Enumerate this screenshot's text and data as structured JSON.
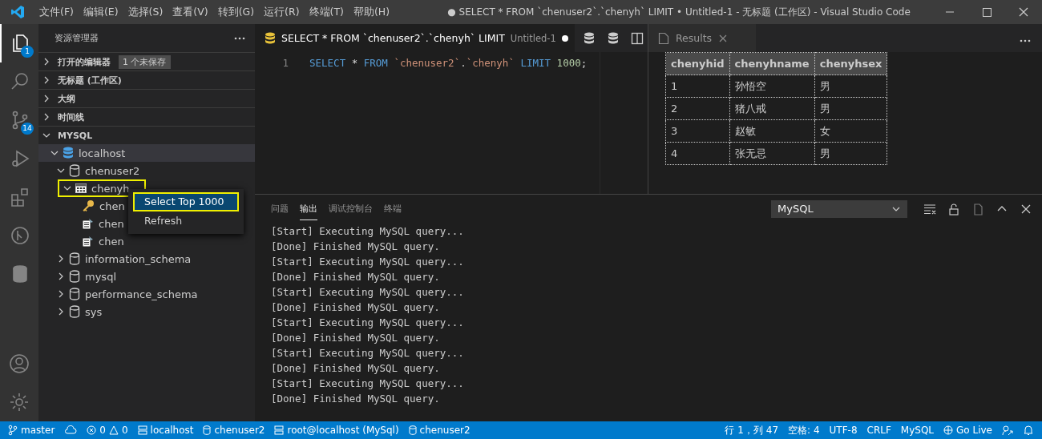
{
  "title_bar": {
    "menu": [
      "文件(F)",
      "编辑(E)",
      "选择(S)",
      "查看(V)",
      "转到(G)",
      "运行(R)",
      "终端(T)",
      "帮助(H)"
    ],
    "title": "● SELECT * FROM `chenuser2`.`chenyh` LIMIT • Untitled-1 - 无标题 (工作区) - Visual Studio Code"
  },
  "activity_bar": [
    {
      "kind": "explorer",
      "badge": "1",
      "selected": true
    },
    {
      "kind": "search",
      "selected": false
    },
    {
      "kind": "source-control",
      "badge": "14",
      "selected": false
    },
    {
      "kind": "run",
      "selected": false
    },
    {
      "kind": "extensions",
      "selected": false
    },
    {
      "kind": "git-graph",
      "selected": false
    },
    {
      "kind": "database",
      "selected": false
    }
  ],
  "sidebar": {
    "title": "资源管理器",
    "sections": [
      {
        "label": "打开的编辑器",
        "badge": "1 个未保存",
        "expanded": false
      },
      {
        "label": "无标题 (工作区)",
        "expanded": false
      },
      {
        "label": "大纲",
        "expanded": false
      },
      {
        "label": "时间线",
        "expanded": false
      },
      {
        "label": "MYSQL",
        "expanded": true
      }
    ],
    "tree": [
      {
        "kind": "server",
        "label": "localhost",
        "expanded": true,
        "selected": true,
        "highlighted": false,
        "children": [
          {
            "kind": "database",
            "label": "chenuser2",
            "expanded": true,
            "selected": false,
            "highlighted": false,
            "children": [
              {
                "kind": "table",
                "label": "chenyh",
                "expanded": true,
                "selected": false,
                "highlighted": true,
                "children": [
                  {
                    "kind": "key-column",
                    "label": "chen"
                  },
                  {
                    "kind": "column",
                    "label": "chen"
                  },
                  {
                    "kind": "column",
                    "label": "chen"
                  }
                ]
              }
            ]
          },
          {
            "kind": "database",
            "label": "information_schema",
            "expanded": false,
            "selected": false,
            "highlighted": false
          },
          {
            "kind": "database",
            "label": "mysql",
            "expanded": false,
            "selected": false,
            "highlighted": false
          },
          {
            "kind": "database",
            "label": "performance_schema",
            "expanded": false,
            "selected": false,
            "highlighted": false
          },
          {
            "kind": "database",
            "label": "sys",
            "expanded": false,
            "selected": false,
            "highlighted": false
          }
        ]
      }
    ]
  },
  "context_menu": [
    {
      "label": "Select Top 1000",
      "selected": true
    },
    {
      "label": "Refresh",
      "selected": false
    }
  ],
  "editor": {
    "tab": {
      "label": "SELECT * FROM `chenuser2`.`chenyh` LIMIT",
      "description": "Untitled-1",
      "dirty": true
    },
    "lines": [
      {
        "number": "1",
        "tokens": [
          {
            "kind": "keyword",
            "text": "SELECT"
          },
          {
            "kind": "operator",
            "text": " *"
          },
          {
            "kind": "keyword",
            "text": " FROM"
          },
          {
            "kind": "string",
            "text": " `chenuser2`"
          },
          {
            "kind": "plain",
            "text": "."
          },
          {
            "kind": "string",
            "text": "`chenyh`"
          },
          {
            "kind": "keyword",
            "text": " LIMIT"
          },
          {
            "kind": "number",
            "text": " 1000"
          },
          {
            "kind": "plain",
            "text": ";"
          }
        ]
      }
    ]
  },
  "results": {
    "tab": "Results",
    "columns": [
      "chenyhid",
      "chenyhname",
      "chenyhsex"
    ],
    "rows": [
      [
        "1",
        "孙悟空",
        "男"
      ],
      [
        "2",
        "猪八戒",
        "男"
      ],
      [
        "3",
        "赵敏",
        "女"
      ],
      [
        "4",
        "张无忌",
        "男"
      ]
    ]
  },
  "panel": {
    "tabs": [
      {
        "label": "问题",
        "selected": false
      },
      {
        "label": "输出",
        "selected": true
      },
      {
        "label": "调试控制台",
        "selected": false
      },
      {
        "label": "终端",
        "selected": false
      }
    ],
    "channel": "MySQL",
    "output": [
      "[Start] Executing MySQL query...",
      "[Done] Finished MySQL query.",
      "[Start] Executing MySQL query...",
      "[Done] Finished MySQL query.",
      "[Start] Executing MySQL query...",
      "[Done] Finished MySQL query.",
      "[Start] Executing MySQL query...",
      "[Done] Finished MySQL query.",
      "[Start] Executing MySQL query...",
      "[Done] Finished MySQL query.",
      "[Start] Executing MySQL query...",
      "[Done] Finished MySQL query."
    ]
  },
  "status_bar": {
    "branch": "master",
    "errors": "0",
    "warnings": "0",
    "connection": "localhost",
    "database": "chenuser2",
    "user": "root@localhost (MySql)",
    "active_database": "chenuser2",
    "position": "行 1，列 47",
    "indent": "空格: 4",
    "encoding": "UTF-8",
    "eol": "CRLF",
    "language": "MySQL",
    "live": "Go Live"
  }
}
